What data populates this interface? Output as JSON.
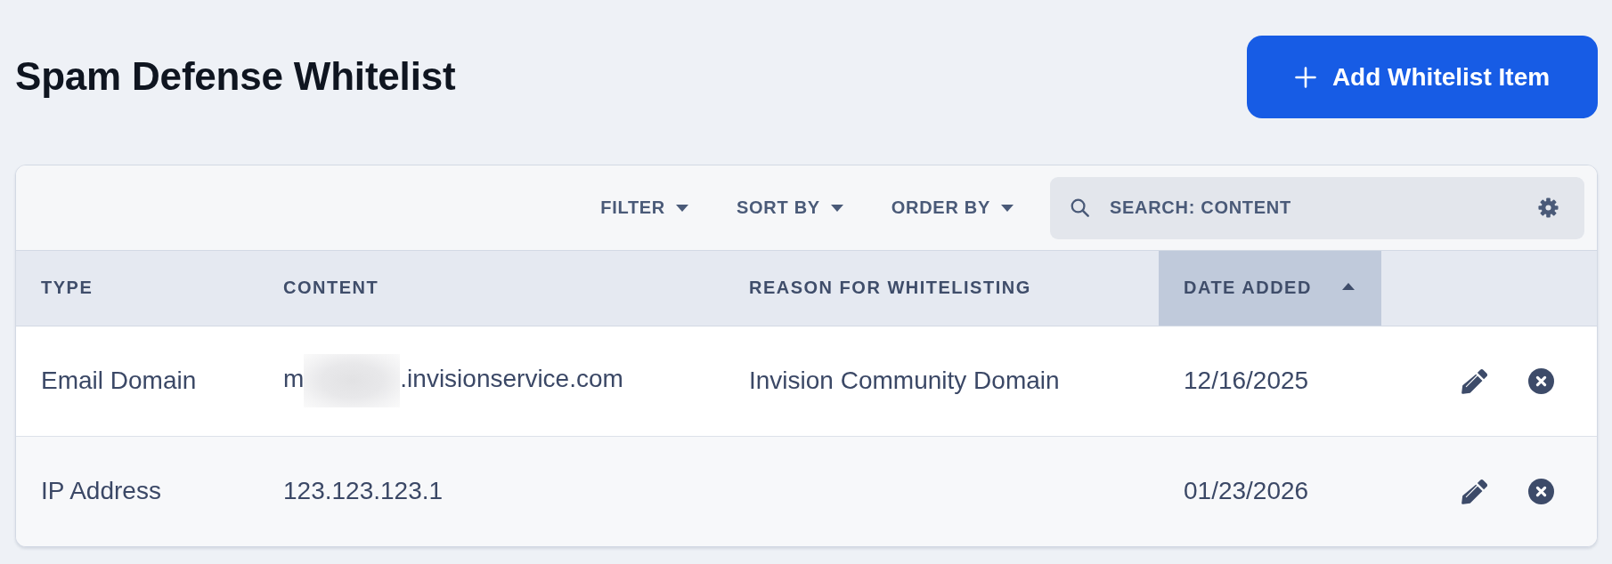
{
  "page": {
    "title": "Spam Defense Whitelist"
  },
  "add_button": {
    "label": "Add Whitelist Item"
  },
  "toolbar": {
    "menus": [
      {
        "label": "FILTER"
      },
      {
        "label": "SORT BY"
      },
      {
        "label": "ORDER BY"
      }
    ],
    "search": {
      "placeholder": "SEARCH: CONTENT"
    }
  },
  "table": {
    "columns": [
      {
        "label": "TYPE",
        "sorted": false
      },
      {
        "label": "CONTENT",
        "sorted": false
      },
      {
        "label": "REASON FOR WHITELISTING",
        "sorted": false
      },
      {
        "label": "DATE ADDED",
        "sorted": true,
        "ascending": true
      }
    ],
    "rows": [
      {
        "type": "Email Domain",
        "content": [
          {
            "kind": "text",
            "text": "m"
          },
          {
            "kind": "redacted"
          },
          {
            "kind": "text",
            "text": ".invisionservice.com"
          }
        ],
        "reason": "Invision Community Domain",
        "date_added": "12/16/2025"
      },
      {
        "type": "IP Address",
        "content": [
          {
            "kind": "text",
            "text": "123.123.123.1"
          }
        ],
        "date_added": "01/23/2026"
      }
    ]
  }
}
